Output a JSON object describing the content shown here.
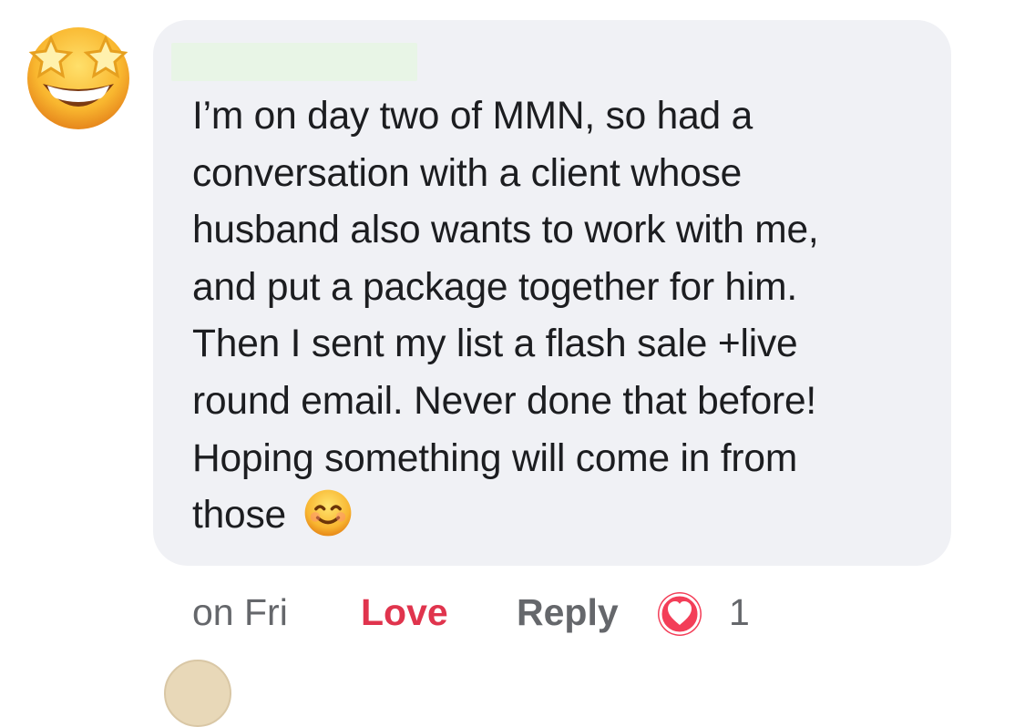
{
  "comment": {
    "avatar_icon": "star-struck-emoji-icon",
    "text_lines": [
      "I’m on day two of MMN, so had a",
      "conversation with a client whose",
      "husband also wants to work with me,",
      "and put a package together for him.",
      "Then I sent my list a flash sale +live",
      "round email. Never done that before!",
      "Hoping something will come in from",
      "those"
    ],
    "inline_emoji": "smiling-face-emoji-icon"
  },
  "actions": {
    "timestamp": "on Fri",
    "love_label": "Love",
    "reply_label": "Reply",
    "reaction_icon": "love-reaction-icon",
    "reaction_count": "1"
  },
  "colors": {
    "bubble": "#f0f1f5",
    "text": "#1c1d20",
    "muted": "#65676b",
    "love": "#e0344d"
  }
}
